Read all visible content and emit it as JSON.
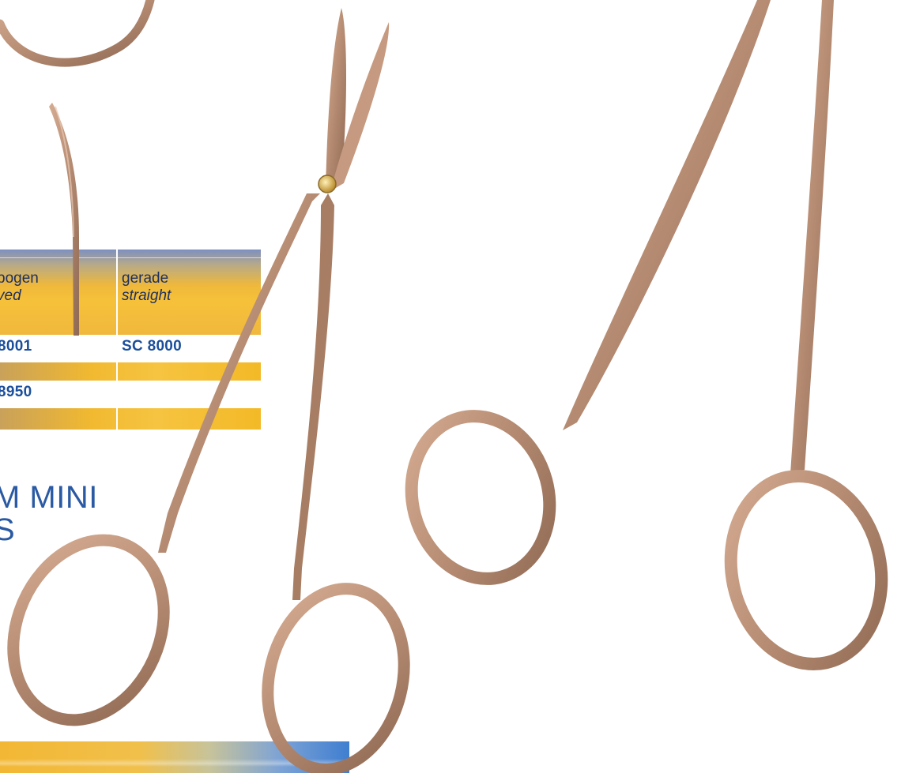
{
  "table": {
    "headers": [
      {
        "de": "bogen",
        "en": "ved"
      },
      {
        "de": "gerade",
        "en": "straight"
      }
    ],
    "rows": [
      {
        "curved": "8001",
        "straight": "SC 8000"
      },
      {
        "curved": "8950",
        "straight": ""
      }
    ]
  },
  "title": {
    "line1": "M MINI",
    "line2": "S"
  },
  "colors": {
    "gold": "#f3b927",
    "code_blue": "#1b4f9b",
    "title_blue": "#2a5aa3",
    "instrument_bronze": "#b58b72"
  }
}
